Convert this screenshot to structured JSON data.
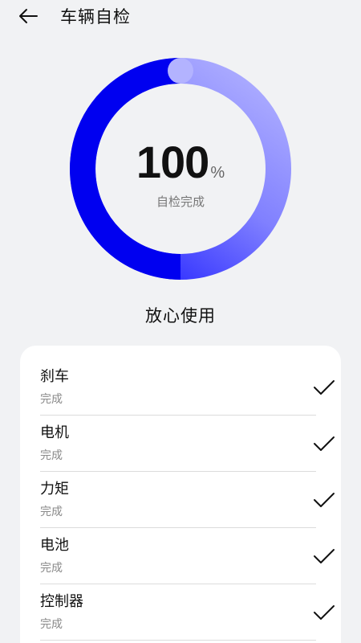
{
  "header": {
    "title": "车辆自检"
  },
  "progress": {
    "value": "100",
    "unit": "%",
    "label": "自检完成",
    "fraction": 1.0
  },
  "colors": {
    "ring_start": "#0000f0",
    "ring_end": "#b0b0ff",
    "background": "#f1f2f4"
  },
  "result": "放心使用",
  "items": [
    {
      "name": "刹车",
      "status": "完成"
    },
    {
      "name": "电机",
      "status": "完成"
    },
    {
      "name": "力矩",
      "status": "完成"
    },
    {
      "name": "电池",
      "status": "完成"
    },
    {
      "name": "控制器",
      "status": "完成"
    }
  ]
}
